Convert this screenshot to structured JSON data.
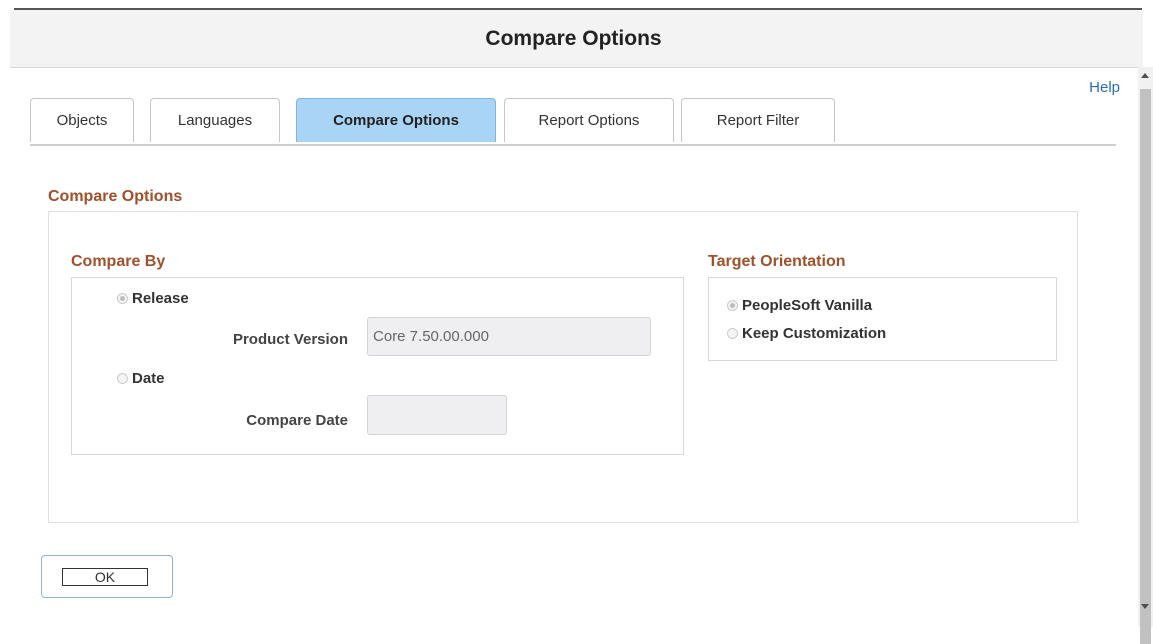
{
  "dialog": {
    "title": "Compare Options",
    "help_label": "Help"
  },
  "tabs": [
    {
      "label": "Objects",
      "active": false
    },
    {
      "label": "Languages",
      "active": false
    },
    {
      "label": "Compare Options",
      "active": true
    },
    {
      "label": "Report Options",
      "active": false
    },
    {
      "label": "Report Filter",
      "active": false
    }
  ],
  "compare_options": {
    "section_title": "Compare Options",
    "compare_by": {
      "title": "Compare By",
      "release_label": "Release",
      "release_selected": true,
      "product_version_label": "Product Version",
      "product_version_value": "Core 7.50.00.000",
      "date_label": "Date",
      "date_selected": false,
      "compare_date_label": "Compare Date",
      "compare_date_value": ""
    },
    "target_orientation": {
      "title": "Target Orientation",
      "vanilla_label": "PeopleSoft Vanilla",
      "vanilla_selected": true,
      "keep_label": "Keep Customization",
      "keep_selected": false
    }
  },
  "footer": {
    "ok_label": "OK"
  }
}
